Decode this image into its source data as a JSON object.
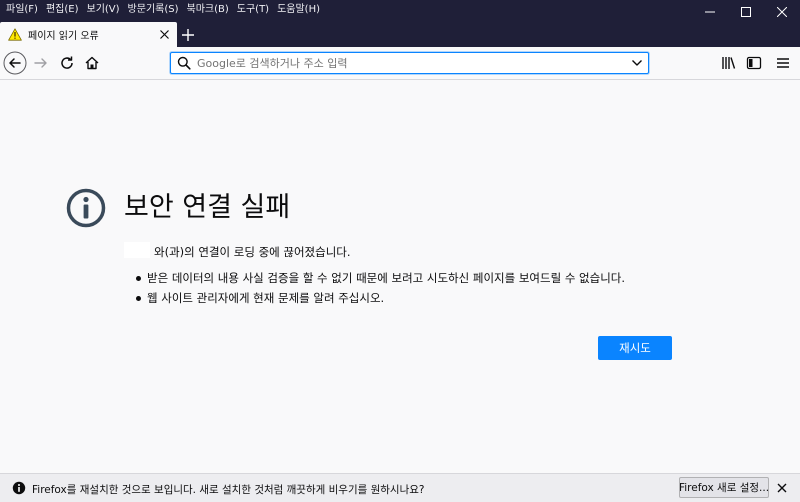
{
  "menubar": {
    "items": [
      "파일(F)",
      "편집(E)",
      "보기(V)",
      "방문기록(S)",
      "북마크(B)",
      "도구(T)",
      "도움말(H)"
    ]
  },
  "tab": {
    "title": "페이지 읽기 오류"
  },
  "urlbar": {
    "placeholder": "Google로 검색하거나 주소 입력"
  },
  "error": {
    "title": "보안 연결 실패",
    "description": "와(과)의 연결이 로딩 중에 끊어졌습니다.",
    "bullets": [
      "받은 데이터의 내용 사실 검증을 할 수 없기 때문에 보려고 시도하신 페이지를 보여드릴 수 없습니다.",
      "웹 사이트 관리자에게 현재 문제를 알려 주십시오."
    ],
    "retry_label": "재시도"
  },
  "notification": {
    "text": "Firefox를 재설치한 것으로 보입니다. 새로 설치한 것처럼 깨끗하게 비우기를 원하시나요?",
    "button_label": "Firefox 새로 설정..."
  },
  "colors": {
    "accent": "#0a84ff",
    "titlebar": "#1f1f38",
    "warning": "#ffe900"
  },
  "icons": [
    "warning-icon",
    "close-icon",
    "plus-icon",
    "back-icon",
    "forward-icon",
    "reload-icon",
    "home-icon",
    "search-icon",
    "chevron-down-icon",
    "library-icon",
    "sidebar-icon",
    "menu-icon",
    "info-icon"
  ]
}
